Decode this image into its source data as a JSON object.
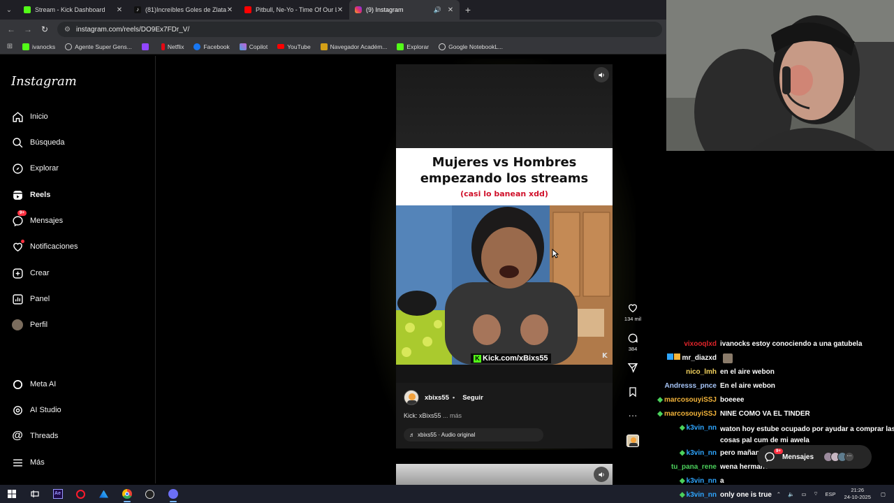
{
  "browser": {
    "tabs": [
      {
        "label": "Stream - Kick Dashboard",
        "icon": "kick-icon",
        "color": "#53fc18"
      },
      {
        "label": "(81)Increíbles Goles de Zlatan I",
        "icon": "tiktok-icon",
        "color": "#ffffff"
      },
      {
        "label": "Pitbull, Ne-Yo - Time Of Our Li",
        "icon": "youtube-icon",
        "color": "#ff0000"
      },
      {
        "label": "(9) Instagram",
        "icon": "instagram-icon",
        "color": "#e1306c"
      }
    ],
    "url": "instagram.com/reels/DO9Ex7FDr_V/",
    "bookmarks": [
      {
        "label": "ivanocks",
        "icon": "kick-icon",
        "color": "#53fc18"
      },
      {
        "label": "Agente Super Gens...",
        "icon": "agent-icon",
        "color": "#cccccc"
      },
      {
        "label": "",
        "icon": "twitch-icon",
        "color": "#9146ff"
      },
      {
        "label": "Netflix",
        "icon": "netflix-icon",
        "color": "#e50914"
      },
      {
        "label": "Facebook",
        "icon": "facebook-icon",
        "color": "#1877f2"
      },
      {
        "label": "Copilot",
        "icon": "copilot-icon",
        "color": "#4aa3df"
      },
      {
        "label": "YouTube",
        "icon": "youtube-icon",
        "color": "#ff0000"
      },
      {
        "label": "Navegador Académ...",
        "icon": "academic-icon",
        "color": "#d4a017"
      },
      {
        "label": "Explorar",
        "icon": "kick-icon",
        "color": "#53fc18"
      },
      {
        "label": "Google NotebookL...",
        "icon": "notebooklm-icon",
        "color": "#dddddd"
      }
    ]
  },
  "instagram": {
    "logo": "Instagram",
    "nav": [
      {
        "label": "Inicio",
        "icon": "home-icon"
      },
      {
        "label": "Búsqueda",
        "icon": "search-icon"
      },
      {
        "label": "Explorar",
        "icon": "compass-icon"
      },
      {
        "label": "Reels",
        "icon": "reels-icon"
      },
      {
        "label": "Mensajes",
        "icon": "messenger-icon",
        "badge": "9+"
      },
      {
        "label": "Notificaciones",
        "icon": "heart-icon"
      },
      {
        "label": "Crear",
        "icon": "plus-square-icon"
      },
      {
        "label": "Panel",
        "icon": "chart-icon"
      },
      {
        "label": "Perfil",
        "icon": "profile-avatar"
      }
    ],
    "nav_bottom": [
      {
        "label": "Meta AI",
        "icon": "meta-ai-icon"
      },
      {
        "label": "AI Studio",
        "icon": "ai-studio-icon"
      },
      {
        "label": "Threads",
        "icon": "threads-icon"
      },
      {
        "label": "Más",
        "icon": "menu-icon"
      }
    ],
    "reel": {
      "title_line1": "Mujeres vs Hombres",
      "title_line2": "empezando los streams",
      "subtitle": "(casi lo banean xdd)",
      "watermark": "Kick.com/xBixs55",
      "owner": "xbixs55",
      "separator": "•",
      "follow_label": "Seguir",
      "caption": "Kick: xBixs55",
      "caption_more": "... más",
      "audio": "xbixs55 · Audio original",
      "likes": "134 mil",
      "comments": "384"
    },
    "messages_pill": {
      "label": "Mensajes",
      "badge": "9+"
    }
  },
  "chat": [
    {
      "user": "vixooqlxd",
      "color": "#e0242a",
      "msg": "ivanocks estoy conociendo a una gatubela",
      "badges": []
    },
    {
      "user": "mr_diazxd",
      "color": "#ffffff",
      "msg": "",
      "badges": [
        "prime",
        "sub"
      ],
      "emote": true
    },
    {
      "user": "nico_lmh",
      "color": "#f4d35e",
      "msg": "en el aire webon",
      "badges": []
    },
    {
      "user": "Andresss_pnce",
      "color": "#a8c7fa",
      "msg": "En el aire webon",
      "badges": []
    },
    {
      "user": "marcosouyiSSJ",
      "color": "#f3b43a",
      "msg": "boeeee",
      "badges": [
        "gem"
      ]
    },
    {
      "user": "marcosouyiSSJ",
      "color": "#f3b43a",
      "msg": "NINE COMO VA EL TINDER",
      "badges": [
        "gem"
      ]
    },
    {
      "user": "k3vin_nn",
      "color": "#2fa6ff",
      "msg": "waton hoy estube ocupado por ayudar a comprar las",
      "msg2": "cosas pal cum de mi awela",
      "badges": [
        "gem"
      ]
    },
    {
      "user": "k3vin_nn",
      "color": "#2fa6ff",
      "msg": "pero mañan",
      "badges": [
        "gem"
      ]
    },
    {
      "user": "tu_pana_rene",
      "color": "#4bd15c",
      "msg": "wena hermano",
      "badges": []
    },
    {
      "user": "k3vin_nn",
      "color": "#2fa6ff",
      "msg": "a",
      "badges": [
        "gem"
      ]
    },
    {
      "user": "k3vin_nn",
      "color": "#2fa6ff",
      "msg": "only one is true",
      "badges": [
        "gem"
      ]
    }
  ],
  "taskbar": {
    "lang": "ESP",
    "time": "21:26",
    "date": "24-10-2025"
  }
}
